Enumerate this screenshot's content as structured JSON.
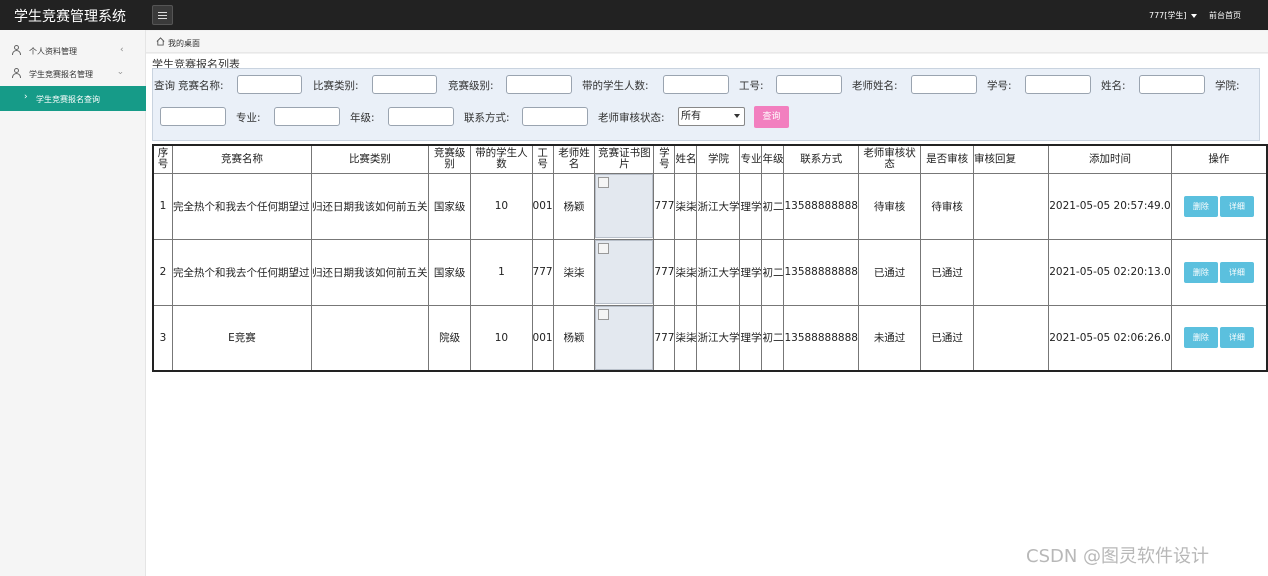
{
  "app": {
    "title": "学生竞赛管理系统"
  },
  "header": {
    "user": "777[学生]",
    "home_link": "前台首页"
  },
  "sidebar": {
    "items": [
      {
        "label": "个人资料管理"
      },
      {
        "label": "学生竞赛报名管理"
      },
      {
        "label": "学生竞赛报名查询"
      }
    ]
  },
  "breadcrumb": "我的桌面",
  "page_title": "学生竞赛报名列表",
  "search": {
    "prefix": "查询",
    "fields": {
      "comp_name": "竞赛名称:",
      "match_type": "比赛类别:",
      "comp_level": "竞赛级别:",
      "student_count": "带的学生人数:",
      "job_no": "工号:",
      "teacher_name": "老师姓名:",
      "student_no": "学号:",
      "name": "姓名:",
      "college": "学院:",
      "major": "专业:",
      "grade": "年级:",
      "contact": "联系方式:",
      "review_status": "老师审核状态:"
    },
    "review_status_value": "所有",
    "button": "查询"
  },
  "table": {
    "headers": [
      "序号",
      "竞赛名称",
      "比赛类别",
      "竞赛级别",
      "带的学生人数",
      "工号",
      "老师姓名",
      "竞赛证书图片",
      "学号",
      "姓名",
      "学院",
      "专业",
      "年级",
      "联系方式",
      "老师审核状态",
      "是否审核",
      "审核回复",
      "添加时间",
      "操作"
    ],
    "rows": [
      {
        "no": "1",
        "comp_name": "完全热个和我去个任何期望过",
        "match_type": "归还日期我该如何前五关",
        "level": "国家级",
        "count": "10",
        "job_no": "001",
        "teacher": "杨颖",
        "student_no": "777",
        "name": "柒柒",
        "college": "浙江大学",
        "major": "理学",
        "grade": "初二",
        "phone": "13588888888",
        "teacher_status": "待审核",
        "audited": "待审核",
        "reply": "",
        "added": "2021-05-05 20:57:49.0"
      },
      {
        "no": "2",
        "comp_name": "完全热个和我去个任何期望过",
        "match_type": "归还日期我该如何前五关",
        "level": "国家级",
        "count": "1",
        "job_no": "777",
        "teacher": "柒柒",
        "student_no": "777",
        "name": "柒柒",
        "college": "浙江大学",
        "major": "理学",
        "grade": "初二",
        "phone": "13588888888",
        "teacher_status": "已通过",
        "audited": "已通过",
        "reply": "",
        "added": "2021-05-05 02:20:13.0"
      },
      {
        "no": "3",
        "comp_name": "E竞赛",
        "match_type": "",
        "level": "院级",
        "count": "10",
        "job_no": "001",
        "teacher": "杨颖",
        "student_no": "777",
        "name": "柒柒",
        "college": "浙江大学",
        "major": "理学",
        "grade": "初二",
        "phone": "13588888888",
        "teacher_status": "未通过",
        "audited": "已通过",
        "reply": "",
        "added": "2021-05-05 02:06:26.0"
      }
    ],
    "actions": {
      "delete": "删除",
      "detail": "详细"
    }
  },
  "watermark": "CSDN @图灵软件设计"
}
